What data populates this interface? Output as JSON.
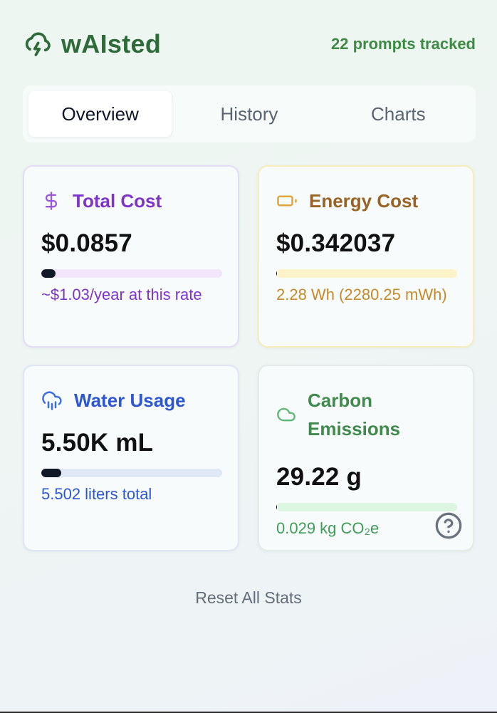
{
  "app": {
    "title": "wAIsted",
    "tracked_label": "22 prompts tracked"
  },
  "tabs": [
    {
      "label": "Overview",
      "active": true
    },
    {
      "label": "History",
      "active": false
    },
    {
      "label": "Charts",
      "active": false
    }
  ],
  "cards": {
    "total_cost": {
      "icon": "dollar-icon",
      "title": "Total Cost",
      "value": "$0.0857",
      "progress": 0.08,
      "subtitle": "~$1.03/year at this rate",
      "accent": "#7e34c9"
    },
    "energy_cost": {
      "icon": "battery-icon",
      "title": "Energy Cost",
      "value": "$0.342037",
      "progress": 0.005,
      "subtitle": "2.28 Wh (2280.25 mWh)",
      "accent": "#c78a2a"
    },
    "water_usage": {
      "icon": "cloud-rain-icon",
      "title": "Water Usage",
      "value": "5.50K mL",
      "progress": 0.11,
      "subtitle": "5.502 liters total",
      "accent": "#2d56d1"
    },
    "carbon_emissions": {
      "icon": "cloud-icon",
      "title": "Carbon Emissions",
      "value": "29.22 g",
      "progress": 0.005,
      "subtitle": "0.029 kg CO₂e",
      "accent": "#3f8a4c"
    }
  },
  "reset_label": "Reset All Stats",
  "colors": {
    "brand": "#2f6b3a",
    "tracked": "#3f8a45"
  }
}
